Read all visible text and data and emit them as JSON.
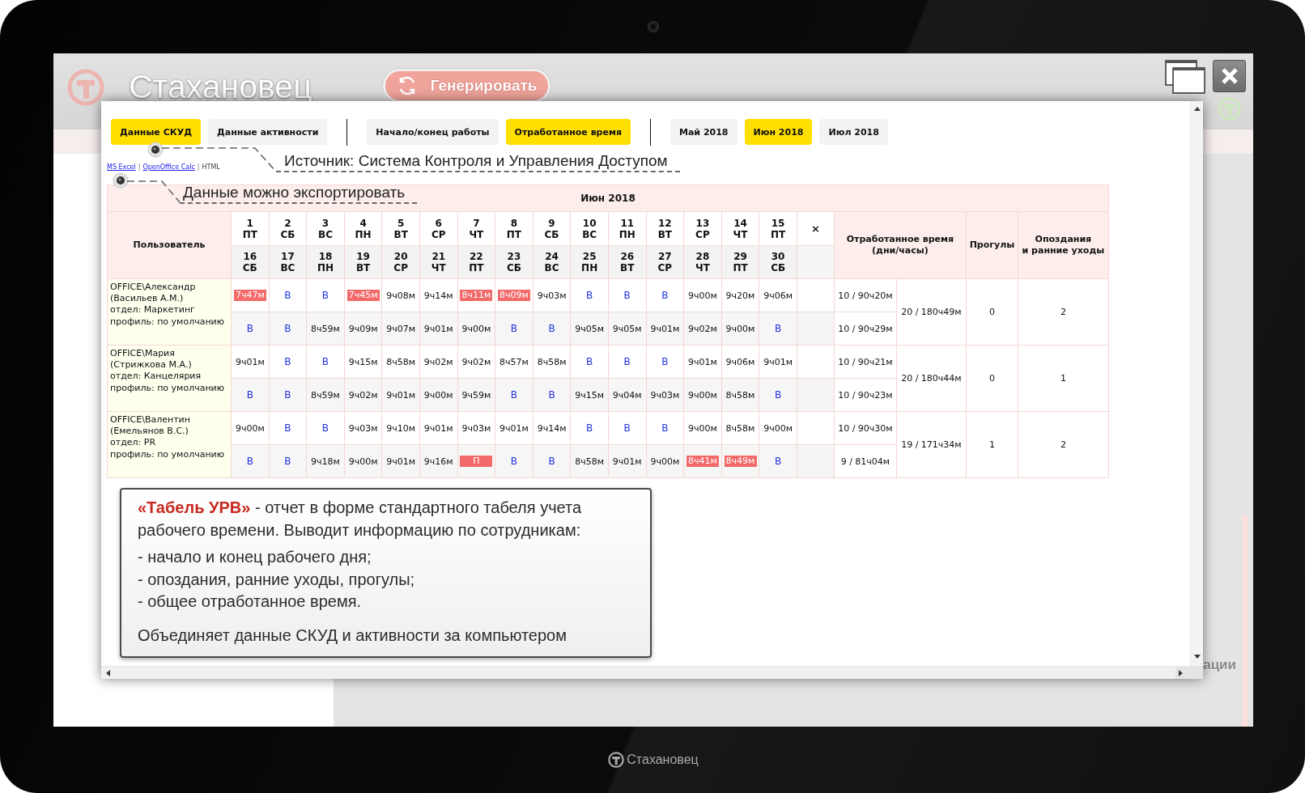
{
  "device": {
    "brand": "Стахановец"
  },
  "app": {
    "logo": "Стахановец",
    "generate_button": "Генерировать",
    "side_label": "ации"
  },
  "report": {
    "tab_groups": [
      {
        "tabs": [
          {
            "label": "Данные СКУД",
            "selected": true
          },
          {
            "label": "Данные активности",
            "selected": false
          }
        ]
      },
      {
        "tabs": [
          {
            "label": "Начало/конец работы",
            "selected": false
          },
          {
            "label": "Отработанное время",
            "selected": true
          }
        ]
      },
      {
        "tabs": [
          {
            "label": "Май 2018",
            "selected": false
          },
          {
            "label": "Июн 2018",
            "selected": true
          },
          {
            "label": "Июл 2018",
            "selected": false
          }
        ]
      }
    ],
    "export_links": [
      {
        "kind": "link",
        "label": "MS Excel"
      },
      {
        "kind": "separator",
        "label": "|"
      },
      {
        "kind": "link",
        "label": "OpenOffice Calc"
      },
      {
        "kind": "separator",
        "label": "|"
      },
      {
        "kind": "current",
        "label": "HTML"
      }
    ],
    "annotations": [
      {
        "text": "Источник: Система Контроля и Управления Доступом"
      },
      {
        "text": "Данные можно экспортировать"
      }
    ],
    "table": {
      "title": "Июн 2018",
      "columns": {
        "user": "Пользователь",
        "extra": "×",
        "worked": "Отработанное время\n(дни/часы)",
        "absences": "Прогулы",
        "late": "Опоздания\nи ранние уходы"
      },
      "day_headers": [
        [
          {
            "day": "1",
            "weekday": "ПТ"
          },
          {
            "day": "2",
            "weekday": "СБ"
          },
          {
            "day": "3",
            "weekday": "ВС"
          },
          {
            "day": "4",
            "weekday": "ПН"
          },
          {
            "day": "5",
            "weekday": "ВТ"
          },
          {
            "day": "6",
            "weekday": "СР"
          },
          {
            "day": "7",
            "weekday": "ЧТ"
          },
          {
            "day": "8",
            "weekday": "ПТ"
          },
          {
            "day": "9",
            "weekday": "СБ"
          },
          {
            "day": "10",
            "weekday": "ВС"
          },
          {
            "day": "11",
            "weekday": "ПН"
          },
          {
            "day": "12",
            "weekday": "ВТ"
          },
          {
            "day": "13",
            "weekday": "СР"
          },
          {
            "day": "14",
            "weekday": "ЧТ"
          },
          {
            "day": "15",
            "weekday": "ПТ"
          }
        ],
        [
          {
            "day": "16",
            "weekday": "СБ"
          },
          {
            "day": "17",
            "weekday": "ВС"
          },
          {
            "day": "18",
            "weekday": "ПН"
          },
          {
            "day": "19",
            "weekday": "ВТ"
          },
          {
            "day": "20",
            "weekday": "СР"
          },
          {
            "day": "21",
            "weekday": "ЧТ"
          },
          {
            "day": "22",
            "weekday": "ПТ"
          },
          {
            "day": "23",
            "weekday": "СБ"
          },
          {
            "day": "24",
            "weekday": "ВС"
          },
          {
            "day": "25",
            "weekday": "ПН"
          },
          {
            "day": "26",
            "weekday": "ВТ"
          },
          {
            "day": "27",
            "weekday": "СР"
          },
          {
            "day": "28",
            "weekday": "ЧТ"
          },
          {
            "day": "29",
            "weekday": "ПТ"
          },
          {
            "day": "30",
            "weekday": "СБ"
          }
        ]
      ],
      "rows": [
        {
          "user": "OFFICE\\Александр\n(Васильев А.М.)\nотдел: Маркетинг\nпрофиль: по умолчанию",
          "halves": [
            {
              "cells": [
                {
                  "value": "7ч47м",
                  "kind": "late"
                },
                {
                  "value": "В",
                  "kind": "weekend"
                },
                {
                  "value": "В",
                  "kind": "weekend"
                },
                {
                  "value": "7ч45м",
                  "kind": "late"
                },
                {
                  "value": "9ч08м",
                  "kind": "time"
                },
                {
                  "value": "9ч14м",
                  "kind": "time"
                },
                {
                  "value": "8ч11м",
                  "kind": "late"
                },
                {
                  "value": "8ч09м",
                  "kind": "late"
                },
                {
                  "value": "9ч03м",
                  "kind": "time"
                },
                {
                  "value": "В",
                  "kind": "weekend"
                },
                {
                  "value": "В",
                  "kind": "weekend"
                },
                {
                  "value": "В",
                  "kind": "weekend"
                },
                {
                  "value": "9ч00м",
                  "kind": "time"
                },
                {
                  "value": "9ч20м",
                  "kind": "time"
                },
                {
                  "value": "9ч06м",
                  "kind": "time"
                }
              ],
              "subtotal": "10 / 90ч20м"
            },
            {
              "cells": [
                {
                  "value": "В",
                  "kind": "weekend"
                },
                {
                  "value": "В",
                  "kind": "weekend"
                },
                {
                  "value": "8ч59м",
                  "kind": "time"
                },
                {
                  "value": "9ч09м",
                  "kind": "time"
                },
                {
                  "value": "9ч07м",
                  "kind": "time"
                },
                {
                  "value": "9ч01м",
                  "kind": "time"
                },
                {
                  "value": "9ч00м",
                  "kind": "time"
                },
                {
                  "value": "В",
                  "kind": "weekend"
                },
                {
                  "value": "В",
                  "kind": "weekend"
                },
                {
                  "value": "9ч05м",
                  "kind": "time"
                },
                {
                  "value": "9ч05м",
                  "kind": "time"
                },
                {
                  "value": "9ч01м",
                  "kind": "time"
                },
                {
                  "value": "9ч02м",
                  "kind": "time"
                },
                {
                  "value": "9ч00м",
                  "kind": "time"
                },
                {
                  "value": "В",
                  "kind": "weekend"
                }
              ],
              "subtotal": "10 / 90ч29м"
            }
          ],
          "total": "20 / 180ч49м",
          "absences": "0",
          "late": "2"
        },
        {
          "user": "OFFICE\\Мария\n(Стрижкова М.А.)\nотдел: Канцелярия\nпрофиль: по умолчанию",
          "halves": [
            {
              "cells": [
                {
                  "value": "9ч01м",
                  "kind": "time"
                },
                {
                  "value": "В",
                  "kind": "weekend"
                },
                {
                  "value": "В",
                  "kind": "weekend"
                },
                {
                  "value": "9ч15м",
                  "kind": "time"
                },
                {
                  "value": "8ч58м",
                  "kind": "time"
                },
                {
                  "value": "9ч02м",
                  "kind": "time"
                },
                {
                  "value": "9ч02м",
                  "kind": "time"
                },
                {
                  "value": "8ч57м",
                  "kind": "time"
                },
                {
                  "value": "8ч58м",
                  "kind": "time"
                },
                {
                  "value": "В",
                  "kind": "weekend"
                },
                {
                  "value": "В",
                  "kind": "weekend"
                },
                {
                  "value": "В",
                  "kind": "weekend"
                },
                {
                  "value": "9ч01м",
                  "kind": "time"
                },
                {
                  "value": "9ч06м",
                  "kind": "time"
                },
                {
                  "value": "9ч01м",
                  "kind": "time"
                }
              ],
              "subtotal": "10 / 90ч21м"
            },
            {
              "cells": [
                {
                  "value": "В",
                  "kind": "weekend"
                },
                {
                  "value": "В",
                  "kind": "weekend"
                },
                {
                  "value": "8ч59м",
                  "kind": "time"
                },
                {
                  "value": "9ч02м",
                  "kind": "time"
                },
                {
                  "value": "9ч01м",
                  "kind": "time"
                },
                {
                  "value": "9ч00м",
                  "kind": "time"
                },
                {
                  "value": "9ч59м",
                  "kind": "time"
                },
                {
                  "value": "В",
                  "kind": "weekend"
                },
                {
                  "value": "В",
                  "kind": "weekend"
                },
                {
                  "value": "9ч15м",
                  "kind": "time"
                },
                {
                  "value": "9ч04м",
                  "kind": "time"
                },
                {
                  "value": "9ч03м",
                  "kind": "time"
                },
                {
                  "value": "9ч00м",
                  "kind": "time"
                },
                {
                  "value": "8ч58м",
                  "kind": "time"
                },
                {
                  "value": "В",
                  "kind": "weekend"
                }
              ],
              "subtotal": "10 / 90ч23м"
            }
          ],
          "total": "20 / 180ч44м",
          "absences": "0",
          "late": "1"
        },
        {
          "user": "OFFICE\\Валентин\n(Емельянов В.С.)\nотдел: PR\nпрофиль: по умолчанию",
          "halves": [
            {
              "cells": [
                {
                  "value": "9ч00м",
                  "kind": "time"
                },
                {
                  "value": "В",
                  "kind": "weekend"
                },
                {
                  "value": "В",
                  "kind": "weekend"
                },
                {
                  "value": "9ч03м",
                  "kind": "time"
                },
                {
                  "value": "9ч10м",
                  "kind": "time"
                },
                {
                  "value": "9ч01м",
                  "kind": "time"
                },
                {
                  "value": "9ч03м",
                  "kind": "time"
                },
                {
                  "value": "9ч01м",
                  "kind": "time"
                },
                {
                  "value": "9ч14м",
                  "kind": "time"
                },
                {
                  "value": "В",
                  "kind": "weekend"
                },
                {
                  "value": "В",
                  "kind": "weekend"
                },
                {
                  "value": "В",
                  "kind": "weekend"
                },
                {
                  "value": "9ч00м",
                  "kind": "time"
                },
                {
                  "value": "8ч58м",
                  "kind": "time"
                },
                {
                  "value": "9ч00м",
                  "kind": "time"
                }
              ],
              "subtotal": "10 / 90ч30м"
            },
            {
              "cells": [
                {
                  "value": "В",
                  "kind": "weekend"
                },
                {
                  "value": "В",
                  "kind": "weekend"
                },
                {
                  "value": "9ч18м",
                  "kind": "time"
                },
                {
                  "value": "9ч00м",
                  "kind": "time"
                },
                {
                  "value": "9ч01м",
                  "kind": "time"
                },
                {
                  "value": "9ч16м",
                  "kind": "time"
                },
                {
                  "value": "П",
                  "kind": "absent"
                },
                {
                  "value": "В",
                  "kind": "weekend"
                },
                {
                  "value": "В",
                  "kind": "weekend"
                },
                {
                  "value": "8ч58м",
                  "kind": "time"
                },
                {
                  "value": "9ч01м",
                  "kind": "time"
                },
                {
                  "value": "9ч00м",
                  "kind": "time"
                },
                {
                  "value": "8ч41м",
                  "kind": "late"
                },
                {
                  "value": "8ч49м",
                  "kind": "late"
                },
                {
                  "value": "В",
                  "kind": "weekend"
                }
              ],
              "subtotal": "9 / 81ч04м"
            }
          ],
          "total": "19 / 171ч34м",
          "absences": "1",
          "late": "2"
        }
      ]
    }
  },
  "callout": {
    "intro": "**«Табель УРВ»** - отчет в форме стандартного табеля учета рабочего времени. Выводит информацию по сотрудникам:",
    "items": [
      "- начало и конец рабочего дня;",
      "- опоздания, ранние уходы, прогулы;",
      "- общее отработанное время."
    ],
    "summary": "Объединяет данные СКУД и активности за компьютером"
  }
}
